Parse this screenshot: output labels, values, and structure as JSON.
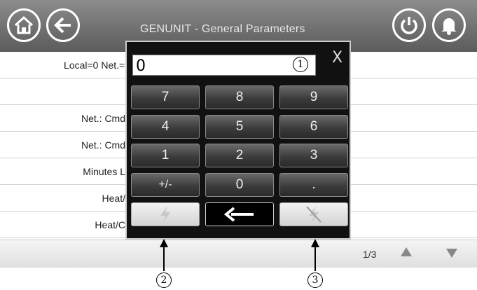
{
  "header": {
    "title": "GENUNIT - General Parameters",
    "home_icon": "home-icon",
    "back_icon": "back-arrow-icon",
    "power_icon": "power-icon",
    "bell_icon": "bell-icon"
  },
  "params": {
    "rows": [
      {
        "label": "Local=0 Net.=1"
      },
      {
        "label": ""
      },
      {
        "label": "Net.: Cmd"
      },
      {
        "label": "Net.: Cmd"
      },
      {
        "label": "Minutes L"
      },
      {
        "label": "Heat/"
      },
      {
        "label": "Heat/C"
      }
    ]
  },
  "footer": {
    "page_indicator": "1/3"
  },
  "keypad": {
    "value": "0",
    "close_label": "X",
    "keys": {
      "k7": "7",
      "k8": "8",
      "k9": "9",
      "k4": "4",
      "k5": "5",
      "k6": "6",
      "k1": "1",
      "k2": "2",
      "k3": "3",
      "sign": "+/-",
      "k0": "0",
      "dot": "."
    },
    "action_icons": [
      "lightning-icon",
      "backspace-arrow-icon",
      "lightning-off-icon"
    ]
  },
  "callouts": {
    "c1": "1",
    "c2": "2",
    "c3": "3"
  },
  "colors": {
    "header_bg": "#6e6e6e",
    "keypad_bg": "#111111",
    "accent_white": "#ffffff"
  }
}
